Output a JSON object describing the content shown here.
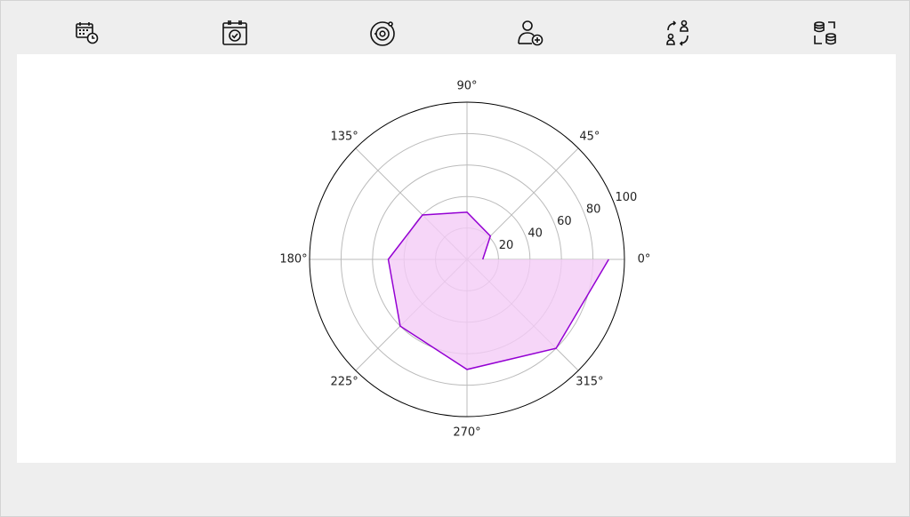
{
  "toolbar": {
    "icons": [
      {
        "name": "calendar-clock-icon"
      },
      {
        "name": "calendar-check-icon"
      },
      {
        "name": "disc-target-icon"
      },
      {
        "name": "user-add-icon"
      },
      {
        "name": "user-swap-icon"
      },
      {
        "name": "database-sync-icon"
      }
    ]
  },
  "colors": {
    "series_line": "#9400d3",
    "series_fill": "#f4ccf6",
    "grid": "#bbbbbb",
    "outer": "#000000"
  },
  "chart_data": {
    "type": "radar",
    "title": "",
    "theta_unit": "degrees",
    "theta_ticks": [
      "0°",
      "45°",
      "90°",
      "135°",
      "180°",
      "225°",
      "270°",
      "315°"
    ],
    "theta_tick_angles": [
      0,
      45,
      90,
      135,
      180,
      225,
      270,
      315
    ],
    "r_ticks": [
      "20",
      "40",
      "60",
      "80",
      "100"
    ],
    "r_tick_values": [
      20,
      40,
      60,
      80,
      100
    ],
    "rlim": [
      0,
      100
    ],
    "grid": true,
    "series": [
      {
        "theta": [
          0,
          45,
          90,
          135,
          180,
          225,
          270,
          315,
          360
        ],
        "r": [
          10,
          21,
          30,
          40,
          50,
          60,
          70,
          80,
          90
        ],
        "filled": true
      }
    ]
  }
}
